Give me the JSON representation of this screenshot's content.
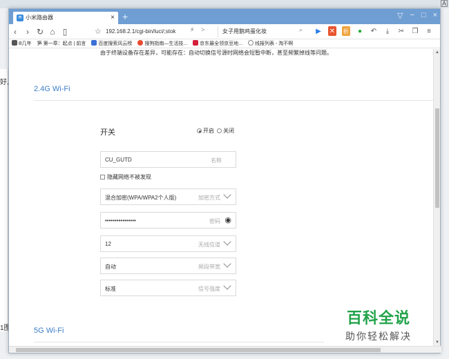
{
  "browser": {
    "tab_title": "小米路由器",
    "tab_close": "×",
    "new_tab": "+",
    "window_controls": [
      "▽",
      "−",
      "□",
      "×"
    ],
    "url": "192.168.2.1/cgi-bin/luci/;stok",
    "search_text": "女子用鹅鸡蛋化妆",
    "bookmarks": [
      {
        "label": "B几年",
        "color": "#555555"
      },
      {
        "label": "笋 第一章：起点 | 前言",
        "color": "#999999"
      },
      {
        "label": "百度搜索风云榜",
        "color": "#3a6fd6"
      },
      {
        "label": "搜狗指南—生活技...",
        "color": "#e84a2f"
      },
      {
        "label": "京东最全领京豆地...",
        "color": "#d21f3c"
      },
      {
        "label": "线报列表 - 淘不啊",
        "color": "#888888"
      }
    ]
  },
  "page": {
    "notice": "由于终端设备存在差异，可能存在：自动切换信号源时网络会短暂中断，甚至频繁掉线等问题。",
    "section_24": "2.4G Wi-Fi",
    "section_5": "5G Wi-Fi",
    "switch_label": "开关",
    "radio_on": "开启",
    "radio_off": "关闭",
    "ssid": {
      "value": "CU_GUTD",
      "hint": "名称"
    },
    "hide_network": "隐藏网络不被发现",
    "encryption": {
      "value": "混合加密(WPA/WPA2个人版)",
      "hint": "加密方式"
    },
    "password": {
      "value": "••••••••••••••••",
      "hint": "密码"
    },
    "channel": {
      "value": "12",
      "hint": "无线信道"
    },
    "bandwidth": {
      "value": "自动",
      "hint": "频段带宽"
    },
    "signal": {
      "value": "标准",
      "hint": "信号强度"
    }
  },
  "watermark": {
    "title": "百科全说",
    "subtitle": "助你轻松解决"
  },
  "background": {
    "left_text_1": "好,",
    "left_text_2": "1图"
  },
  "colors": {
    "accent": "#3b7ec7",
    "tabbar": "#6f9ed3",
    "watermark_green": "#22a34a"
  }
}
